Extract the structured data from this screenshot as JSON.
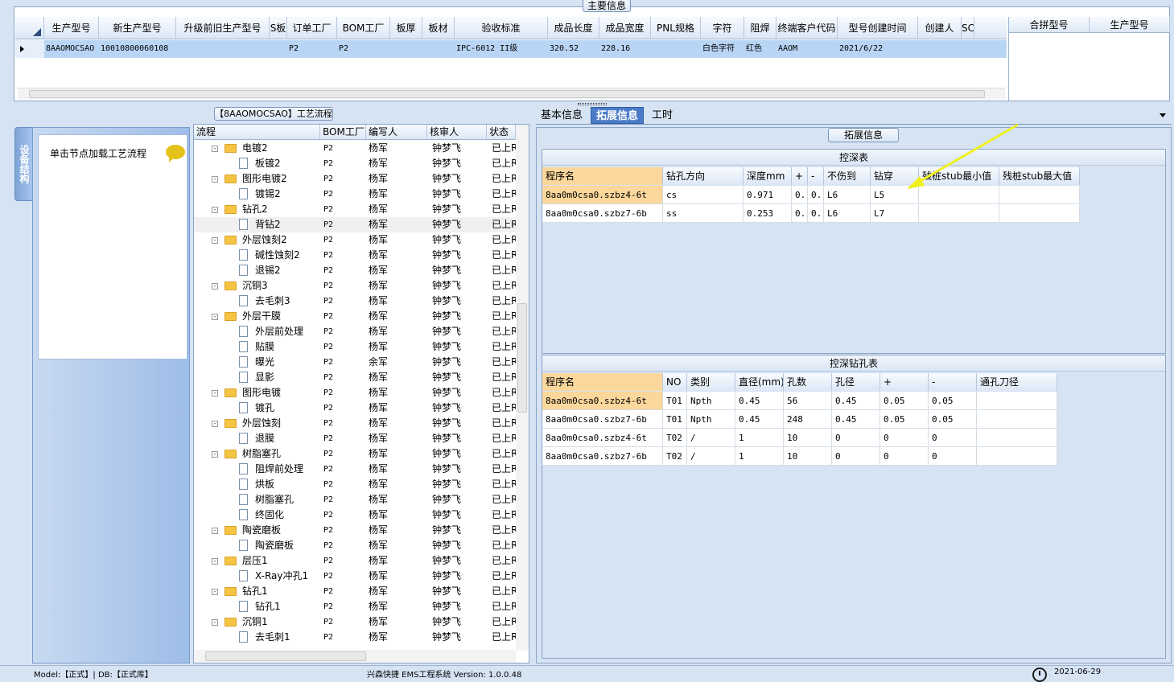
{
  "main_info": {
    "title": "主要信息",
    "columns": [
      "生产型号",
      "新生产型号",
      "升级前旧生产型号",
      "S板",
      "订单工厂",
      "BOM工厂",
      "板厚",
      "板材",
      "验收标准",
      "成品长度",
      "成品宽度",
      "PNL规格",
      "字符",
      "阻焊",
      "终端客户代码",
      "型号创建时间",
      "创建人",
      "SC"
    ],
    "row": [
      "8AAOMOCSAO",
      "10010800060108",
      "",
      "",
      "P2",
      "P2",
      "",
      "",
      "IPC-6012 II级",
      "320.52",
      "228.16",
      "",
      "白色字符",
      "红色",
      "AAOM",
      "2021/6/22",
      "",
      ""
    ],
    "merge_columns": [
      "合拼型号",
      "生产型号"
    ]
  },
  "sidebar": {
    "tab_label": "设备结构",
    "hint": "单击节点加载工艺流程"
  },
  "process": {
    "title": "【8AAOMOCSAO】工艺流程",
    "columns": [
      "流程",
      "BOM工厂",
      "编写人",
      "核审人",
      "状态"
    ],
    "rows": [
      {
        "name": "电镀2",
        "level": 0,
        "bom": "P2",
        "writer": "杨军",
        "reviewer": "钟梦飞",
        "status": "已上R"
      },
      {
        "name": "板镀2",
        "level": 1,
        "bom": "P2",
        "writer": "杨军",
        "reviewer": "钟梦飞",
        "status": "已上R"
      },
      {
        "name": "图形电镀2",
        "level": 0,
        "bom": "P2",
        "writer": "杨军",
        "reviewer": "钟梦飞",
        "status": "已上R"
      },
      {
        "name": "镀锡2",
        "level": 1,
        "bom": "P2",
        "writer": "杨军",
        "reviewer": "钟梦飞",
        "status": "已上R"
      },
      {
        "name": "钻孔2",
        "level": 0,
        "bom": "P2",
        "writer": "杨军",
        "reviewer": "钟梦飞",
        "status": "已上R"
      },
      {
        "name": "背钻2",
        "level": 1,
        "bom": "P2",
        "writer": "杨军",
        "reviewer": "钟梦飞",
        "status": "已上R",
        "selected": true
      },
      {
        "name": "外层蚀刻2",
        "level": 0,
        "bom": "P2",
        "writer": "杨军",
        "reviewer": "钟梦飞",
        "status": "已上R"
      },
      {
        "name": "碱性蚀刻2",
        "level": 1,
        "bom": "P2",
        "writer": "杨军",
        "reviewer": "钟梦飞",
        "status": "已上R"
      },
      {
        "name": "退锡2",
        "level": 1,
        "bom": "P2",
        "writer": "杨军",
        "reviewer": "钟梦飞",
        "status": "已上R"
      },
      {
        "name": "沉铜3",
        "level": 0,
        "bom": "P2",
        "writer": "杨军",
        "reviewer": "钟梦飞",
        "status": "已上R"
      },
      {
        "name": "去毛刺3",
        "level": 1,
        "bom": "P2",
        "writer": "杨军",
        "reviewer": "钟梦飞",
        "status": "已上R"
      },
      {
        "name": "外层干膜",
        "level": 0,
        "bom": "P2",
        "writer": "杨军",
        "reviewer": "钟梦飞",
        "status": "已上R"
      },
      {
        "name": "外层前处理",
        "level": 1,
        "bom": "P2",
        "writer": "杨军",
        "reviewer": "钟梦飞",
        "status": "已上R"
      },
      {
        "name": "贴膜",
        "level": 1,
        "bom": "P2",
        "writer": "杨军",
        "reviewer": "钟梦飞",
        "status": "已上R"
      },
      {
        "name": "曝光",
        "level": 1,
        "bom": "P2",
        "writer": "余军",
        "reviewer": "钟梦飞",
        "status": "已上R"
      },
      {
        "name": "显影",
        "level": 1,
        "bom": "P2",
        "writer": "杨军",
        "reviewer": "钟梦飞",
        "status": "已上R"
      },
      {
        "name": "图形电镀",
        "level": 0,
        "bom": "P2",
        "writer": "杨军",
        "reviewer": "钟梦飞",
        "status": "已上R"
      },
      {
        "name": "镀孔",
        "level": 1,
        "bom": "P2",
        "writer": "杨军",
        "reviewer": "钟梦飞",
        "status": "已上R"
      },
      {
        "name": "外层蚀刻",
        "level": 0,
        "bom": "P2",
        "writer": "杨军",
        "reviewer": "钟梦飞",
        "status": "已上R"
      },
      {
        "name": "退膜",
        "level": 1,
        "bom": "P2",
        "writer": "杨军",
        "reviewer": "钟梦飞",
        "status": "已上R"
      },
      {
        "name": "树脂塞孔",
        "level": 0,
        "bom": "P2",
        "writer": "杨军",
        "reviewer": "钟梦飞",
        "status": "已上R"
      },
      {
        "name": "阻焊前处理",
        "level": 1,
        "bom": "P2",
        "writer": "杨军",
        "reviewer": "钟梦飞",
        "status": "已上R"
      },
      {
        "name": "烘板",
        "level": 1,
        "bom": "P2",
        "writer": "杨军",
        "reviewer": "钟梦飞",
        "status": "已上R"
      },
      {
        "name": "树脂塞孔",
        "level": 1,
        "bom": "P2",
        "writer": "杨军",
        "reviewer": "钟梦飞",
        "status": "已上R"
      },
      {
        "name": "终固化",
        "level": 1,
        "bom": "P2",
        "writer": "杨军",
        "reviewer": "钟梦飞",
        "status": "已上R"
      },
      {
        "name": "陶瓷磨板",
        "level": 0,
        "bom": "P2",
        "writer": "杨军",
        "reviewer": "钟梦飞",
        "status": "已上R"
      },
      {
        "name": "陶瓷磨板",
        "level": 1,
        "bom": "P2",
        "writer": "杨军",
        "reviewer": "钟梦飞",
        "status": "已上R"
      },
      {
        "name": "层压1",
        "level": 0,
        "bom": "P2",
        "writer": "杨军",
        "reviewer": "钟梦飞",
        "status": "已上R"
      },
      {
        "name": "X-Ray冲孔1",
        "level": 1,
        "bom": "P2",
        "writer": "杨军",
        "reviewer": "钟梦飞",
        "status": "已上R"
      },
      {
        "name": "钻孔1",
        "level": 0,
        "bom": "P2",
        "writer": "杨军",
        "reviewer": "钟梦飞",
        "status": "已上R"
      },
      {
        "name": "钻孔1",
        "level": 1,
        "bom": "P2",
        "writer": "杨军",
        "reviewer": "钟梦飞",
        "status": "已上R"
      },
      {
        "name": "沉铜1",
        "level": 0,
        "bom": "P2",
        "writer": "杨军",
        "reviewer": "钟梦飞",
        "status": "已上R"
      },
      {
        "name": "去毛刺1",
        "level": 1,
        "bom": "P2",
        "writer": "杨军",
        "reviewer": "钟梦飞",
        "status": "已上R"
      }
    ]
  },
  "tabs": {
    "items": [
      "基本信息",
      "拓展信息",
      "工时"
    ],
    "active": 1
  },
  "ext": {
    "title": "拓展信息",
    "depth_table": {
      "caption": "控深表",
      "columns": [
        "程序名",
        "钻孔方向",
        "深度mm",
        "+",
        "-",
        "不伤到",
        "钻穿",
        "残桩stub最小值",
        "残桩stub最大值"
      ],
      "rows": [
        [
          "8aa0m0csa0.szbz4-6t",
          "cs",
          "0.971",
          "0..",
          "0..",
          "L6",
          "L5",
          "",
          ""
        ],
        [
          "8aa0m0csa0.szbz7-6b",
          "ss",
          "0.253",
          "0..",
          "0..",
          "L6",
          "L7",
          "",
          ""
        ]
      ]
    },
    "drill_table": {
      "caption": "控深钻孔表",
      "columns": [
        "程序名",
        "NO",
        "类别",
        "直径(mm)",
        "孔数",
        "孔径",
        "+",
        "-",
        "通孔刀径"
      ],
      "rows": [
        [
          "8aa0m0csa0.szbz4-6t",
          "T01",
          "Npth",
          "0.45",
          "56",
          "0.45",
          "0.05",
          "0.05",
          ""
        ],
        [
          "8aa0m0csa0.szbz7-6b",
          "T01",
          "Npth",
          "0.45",
          "248",
          "0.45",
          "0.05",
          "0.05",
          ""
        ],
        [
          "8aa0m0csa0.szbz4-6t",
          "T02",
          "/",
          "1",
          "10",
          "0",
          "0",
          "0",
          ""
        ],
        [
          "8aa0m0csa0.szbz7-6b",
          "T02",
          "/",
          "1",
          "10",
          "0",
          "0",
          "0",
          ""
        ]
      ]
    }
  },
  "status": {
    "left": "Model:【正式】| DB:【正式库】",
    "middle": "兴森快捷 EMS工程系统 Version: 1.0.0.48",
    "right": "2021-06-29"
  },
  "colors": {
    "accent": "#4a7ac8",
    "highlight": "#fbd79b",
    "arrow": "#f0f020"
  }
}
